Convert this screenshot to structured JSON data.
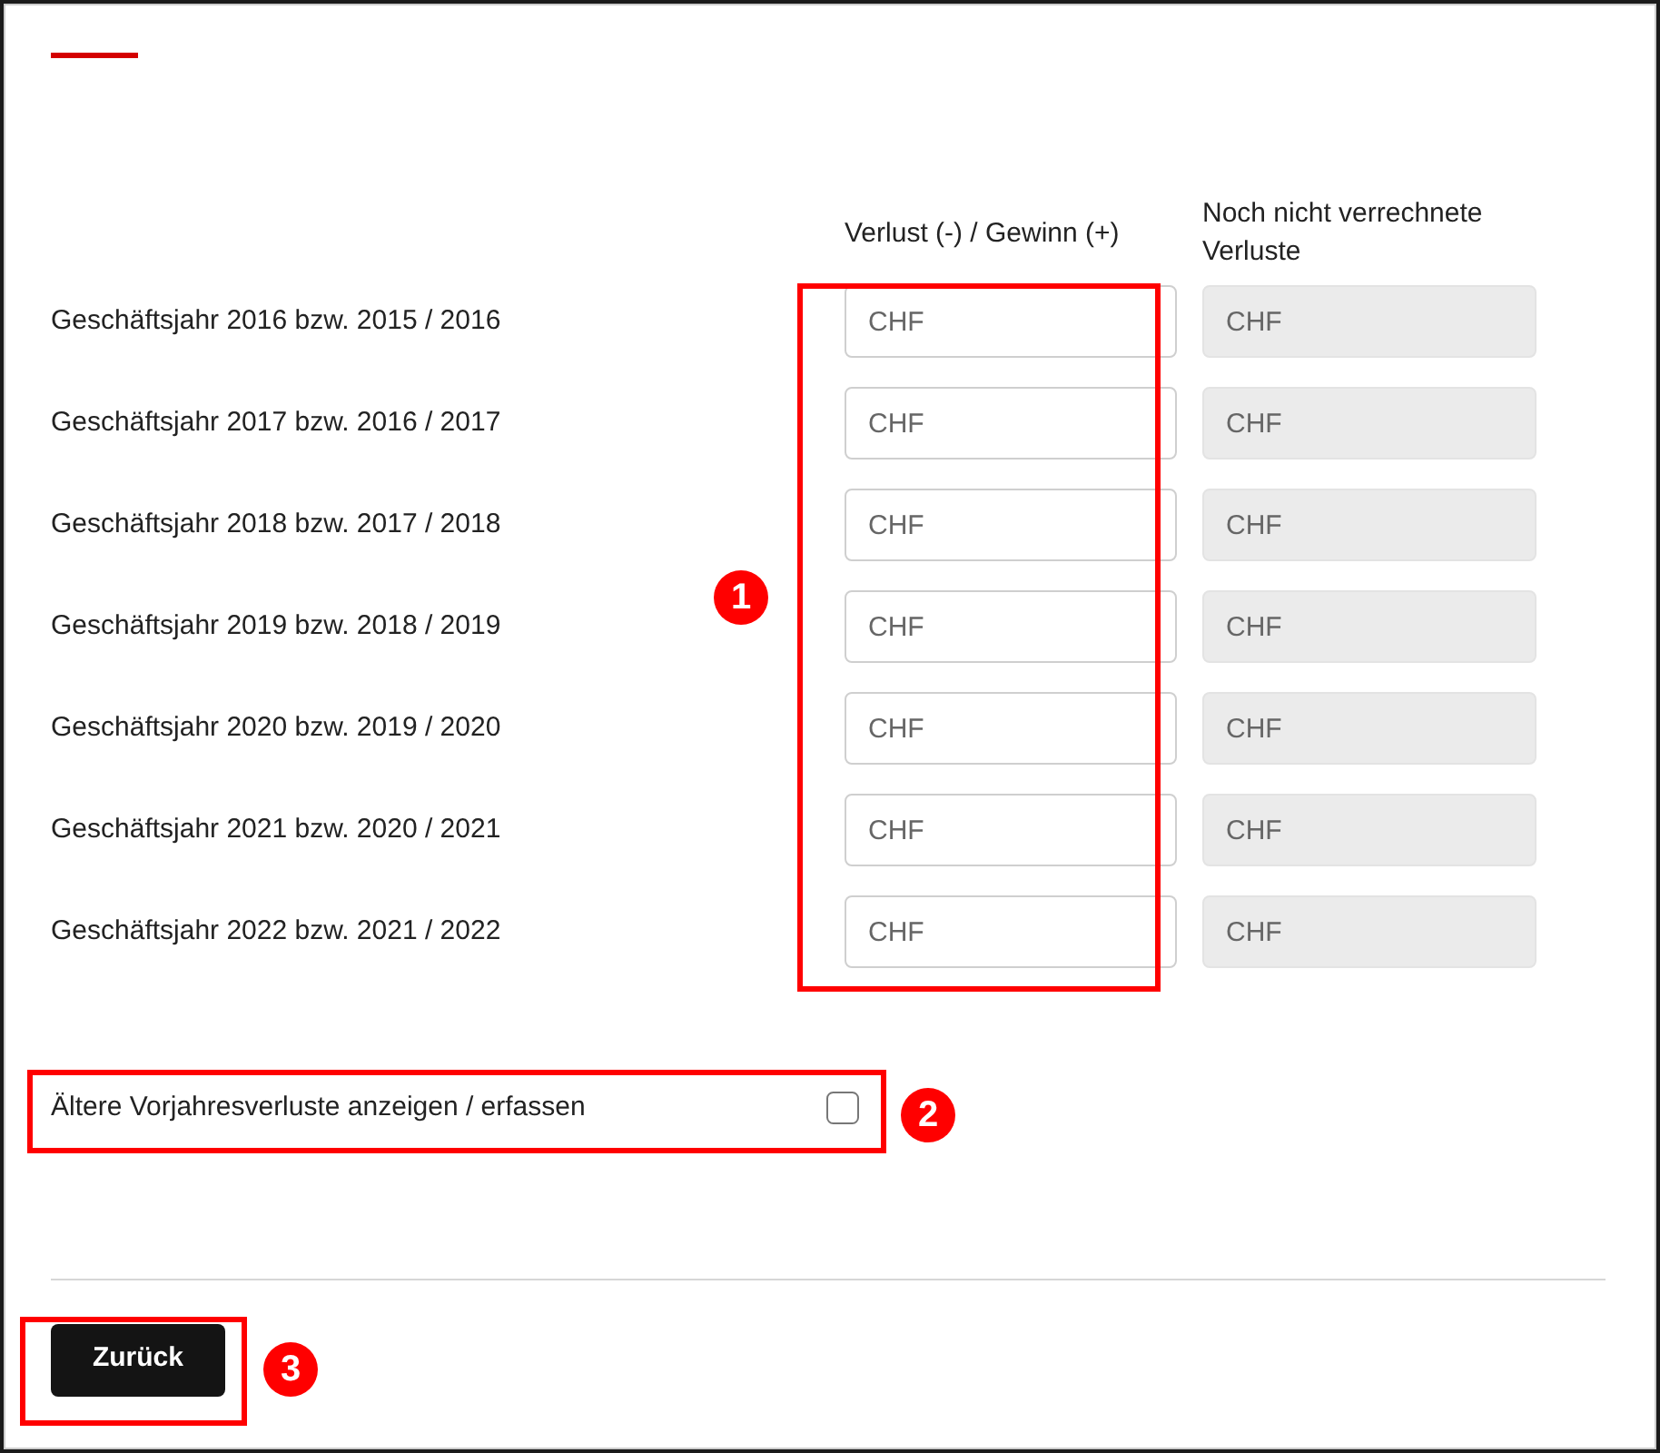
{
  "columns": [
    "Verlust (-) / Gewinn (+)",
    "Noch nicht verrechnete Verluste"
  ],
  "rows": [
    {
      "label": "Geschäftsjahr 2016 bzw. 2015 / 2016",
      "fields": [
        {
          "placeholder": "CHF",
          "disabled": false
        },
        {
          "placeholder": "CHF",
          "disabled": true
        }
      ]
    },
    {
      "label": "Geschäftsjahr 2017 bzw. 2016 / 2017",
      "fields": [
        {
          "placeholder": "CHF",
          "disabled": false
        },
        {
          "placeholder": "CHF",
          "disabled": true
        }
      ]
    },
    {
      "label": "Geschäftsjahr 2018 bzw. 2017 / 2018",
      "fields": [
        {
          "placeholder": "CHF",
          "disabled": false
        },
        {
          "placeholder": "CHF",
          "disabled": true
        }
      ]
    },
    {
      "label": "Geschäftsjahr 2019 bzw. 2018 / 2019",
      "fields": [
        {
          "placeholder": "CHF",
          "disabled": false
        },
        {
          "placeholder": "CHF",
          "disabled": true
        }
      ]
    },
    {
      "label": "Geschäftsjahr 2020 bzw. 2019 / 2020",
      "fields": [
        {
          "placeholder": "CHF",
          "disabled": false
        },
        {
          "placeholder": "CHF",
          "disabled": true
        }
      ]
    },
    {
      "label": "Geschäftsjahr 2021 bzw. 2020 / 2021",
      "fields": [
        {
          "placeholder": "CHF",
          "disabled": false
        },
        {
          "placeholder": "CHF",
          "disabled": true
        }
      ]
    },
    {
      "label": "Geschäftsjahr 2022 bzw. 2021 / 2022",
      "fields": [
        {
          "placeholder": "CHF",
          "disabled": false
        },
        {
          "placeholder": "CHF",
          "disabled": true
        }
      ]
    }
  ],
  "older_losses": {
    "label": "Ältere Vorjahresverluste anzeigen / erfassen",
    "checked": false
  },
  "buttons": [
    "Zurück"
  ],
  "annotations": [
    {
      "number": "1"
    },
    {
      "number": "2"
    },
    {
      "number": "3"
    }
  ]
}
